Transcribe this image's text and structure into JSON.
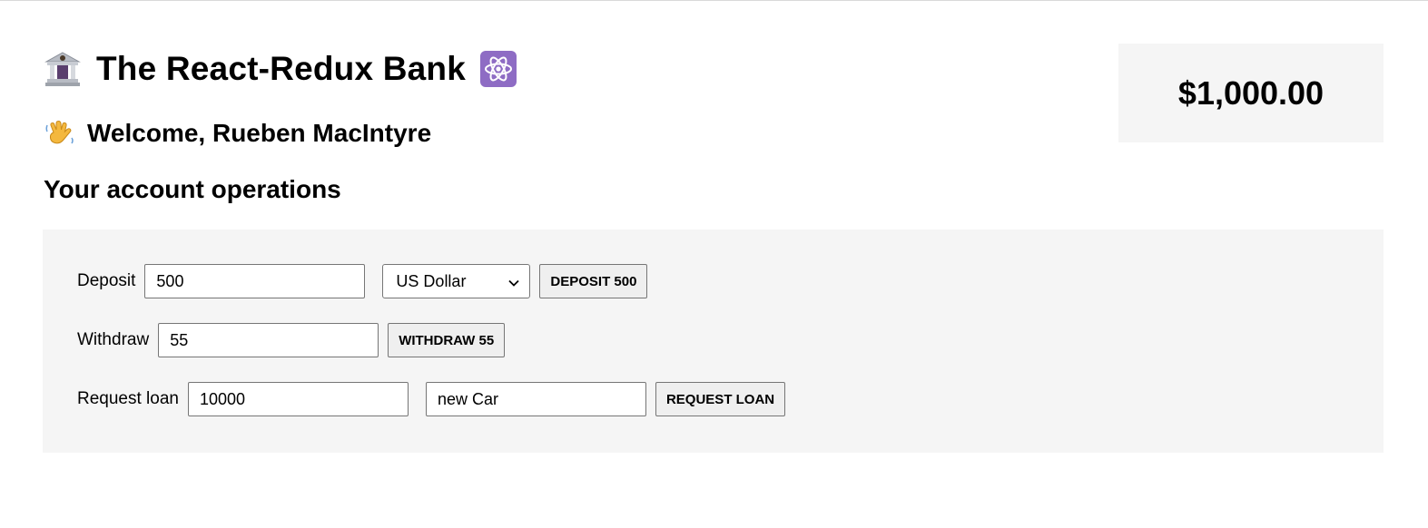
{
  "header": {
    "title": "The React-Redux Bank",
    "bank_icon": "bank-icon",
    "react_icon": "atom-icon"
  },
  "welcome": {
    "text": "Welcome, Rueben MacIntyre",
    "icon": "waving-hand-icon"
  },
  "balance": {
    "amount": "$1,000.00"
  },
  "operations": {
    "title": "Your account operations",
    "deposit": {
      "label": "Deposit",
      "amount_value": "500",
      "currency_selected": "US Dollar",
      "button_label": "DEPOSIT 500"
    },
    "withdraw": {
      "label": "Withdraw",
      "amount_value": "55",
      "button_label": "WITHDRAW 55"
    },
    "loan": {
      "label": "Request loan",
      "amount_value": "10000",
      "purpose_value": "new Car",
      "button_label": "REQUEST LOAN"
    }
  },
  "colors": {
    "panel_background": "#f5f5f5",
    "button_background": "#efefef",
    "react_icon_background": "#8e6cc4"
  }
}
